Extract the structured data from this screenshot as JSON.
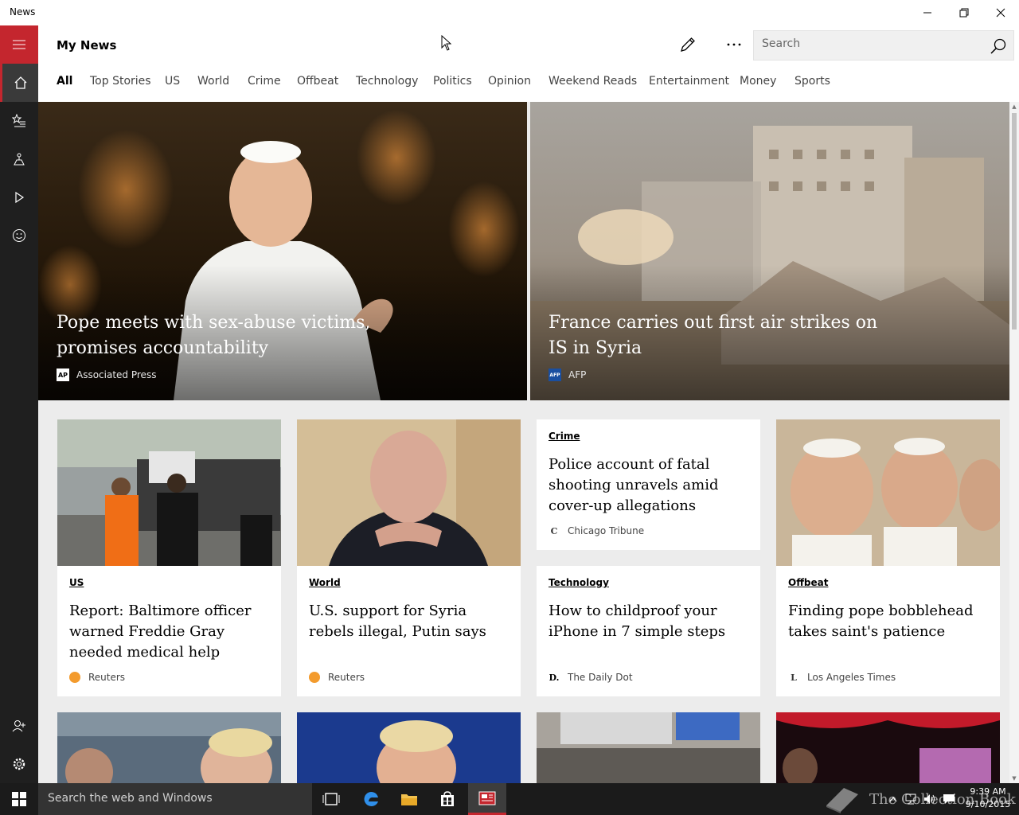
{
  "app": {
    "title": "News"
  },
  "header": {
    "page_title": "My News",
    "search_placeholder": "Search",
    "tabs": [
      "All",
      "Top Stories",
      "US",
      "World",
      "Crime",
      "Offbeat",
      "Technology",
      "Politics",
      "Opinion",
      "Weekend Reads",
      "Entertainment",
      "Money",
      "Sports"
    ]
  },
  "rail": [
    "menu-icon",
    "home-icon",
    "interests-icon",
    "places-icon",
    "video-icon",
    "smiley-icon",
    "account-icon",
    "gear-icon"
  ],
  "hero": [
    {
      "title": "Pope meets with sex-abuse victims, promises accountability",
      "source": "Associated Press",
      "logo": "AP"
    },
    {
      "title": "France carries out first air strikes on IS in Syria",
      "source": "AFP",
      "logo": "AFP"
    }
  ],
  "cards": [
    {
      "category": "US",
      "title": "Report: Baltimore officer warned Freddie Gray needed medical help",
      "source": "Reuters",
      "logo": ""
    },
    {
      "category": "World",
      "title": "U.S. support for Syria rebels illegal, Putin says",
      "source": "Reuters",
      "logo": ""
    },
    {
      "category": "Crime",
      "title": "Police account of fatal shooting unravels amid cover-up allegations",
      "source": "Chicago Tribune",
      "logo": "C"
    },
    {
      "category": "Technology",
      "title": "How to childproof your iPhone in 7 simple steps",
      "source": "The Daily Dot",
      "logo": "D."
    },
    {
      "category": "Offbeat",
      "title": "Finding pope bobblehead takes saint's patience",
      "source": "Los Angeles Times",
      "logo": "L"
    }
  ],
  "taskbar": {
    "search_text": "Search the web and Windows",
    "time": "9:39 AM",
    "date": "9/10/2015",
    "watermark": "The Collection Book"
  },
  "colors": {
    "accent": "#c4262e",
    "rail": "#1f1f1f",
    "content_bg": "#ececec"
  }
}
